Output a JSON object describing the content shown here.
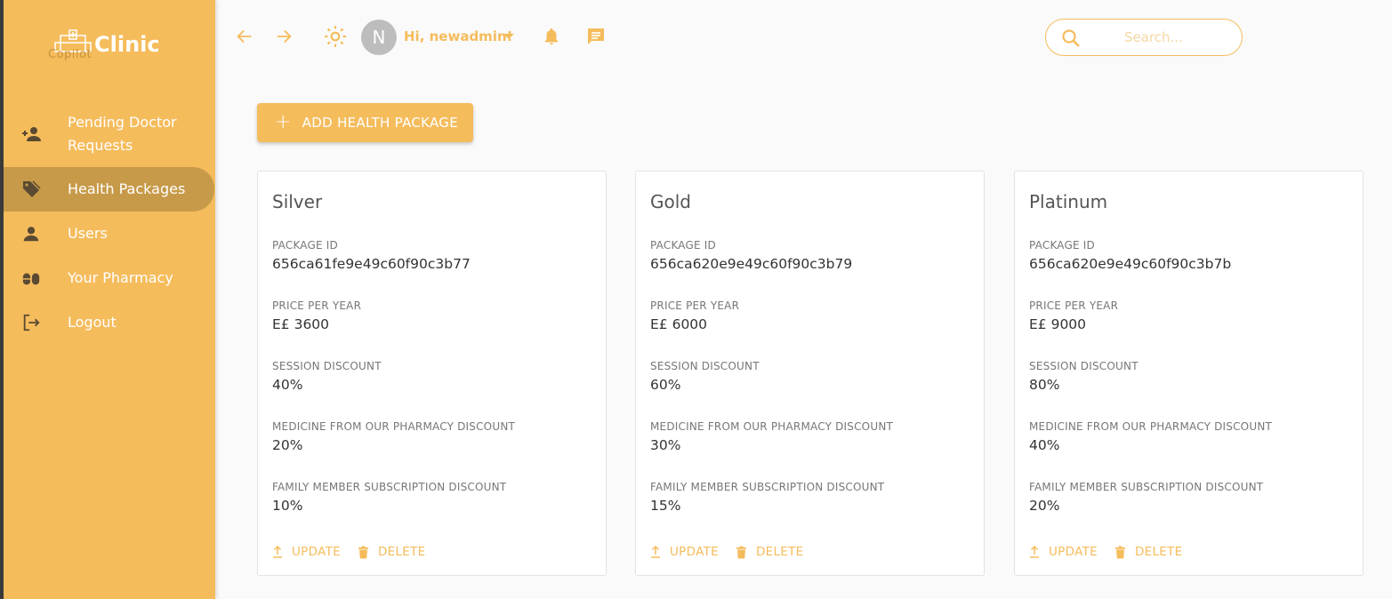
{
  "brand": {
    "logo_sub": "Copilot",
    "name": "Clinic",
    "accent": "#f5bc5c",
    "active_bg": "#c79a49"
  },
  "sidebar": {
    "items": [
      {
        "label": "Pending Doctor Requests",
        "icon": "person-add-icon"
      },
      {
        "label": "Health Packages",
        "icon": "tag-icon",
        "active": true
      },
      {
        "label": "Users",
        "icon": "person-icon"
      },
      {
        "label": "Your Pharmacy",
        "icon": "pills-icon"
      },
      {
        "label": "Logout",
        "icon": "logout-icon"
      }
    ]
  },
  "header": {
    "avatar_letter": "N",
    "greeting": "Hi, newadmin!",
    "search_placeholder": "Search..."
  },
  "main": {
    "add_button_label": "ADD HEALTH PACKAGE",
    "labels": {
      "package_id": "PACKAGE ID",
      "price": "PRICE PER YEAR",
      "session": "SESSION DISCOUNT",
      "medicine": "MEDICINE FROM OUR PHARMACY DISCOUNT",
      "family": "FAMILY MEMBER SUBSCRIPTION DISCOUNT",
      "update": "UPDATE",
      "delete": "DELETE"
    },
    "packages": [
      {
        "name": "Silver",
        "id": "656ca61fe9e49c60f90c3b77",
        "price": "E£ 3600",
        "session": "40%",
        "medicine": "20%",
        "family": "10%"
      },
      {
        "name": "Gold",
        "id": "656ca620e9e49c60f90c3b79",
        "price": "E£ 6000",
        "session": "60%",
        "medicine": "30%",
        "family": "15%"
      },
      {
        "name": "Platinum",
        "id": "656ca620e9e49c60f90c3b7b",
        "price": "E£ 9000",
        "session": "80%",
        "medicine": "40%",
        "family": "20%"
      }
    ]
  }
}
